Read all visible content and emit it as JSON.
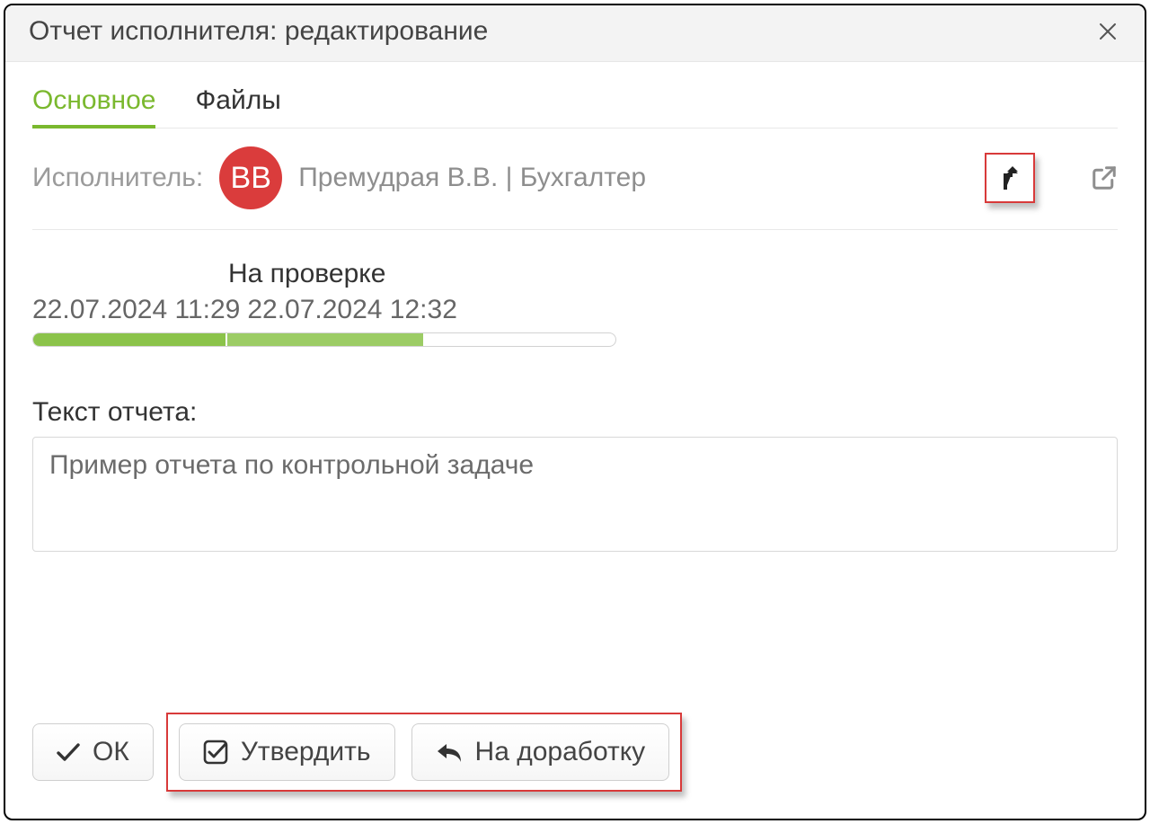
{
  "header": {
    "title": "Отчет исполнителя: редактирование"
  },
  "tabs": {
    "main": "Основное",
    "files": "Файлы"
  },
  "executor": {
    "label": "Исполнитель:",
    "initials": "ВВ",
    "name": "Премудрая В.В. | Бухгалтер"
  },
  "status": {
    "label": "На проверке",
    "date1": "22.07.2024 11:29",
    "date2": "22.07.2024 12:32",
    "progress_percent": 67
  },
  "report": {
    "label": "Текст отчета:",
    "value": "Пример отчета по контрольной задаче"
  },
  "footer": {
    "ok": "ОК",
    "approve": "Утвердить",
    "revise": "На доработку"
  },
  "colors": {
    "accent": "#7ab82e",
    "danger": "#d83a3a",
    "avatar": "#da3c3c"
  }
}
